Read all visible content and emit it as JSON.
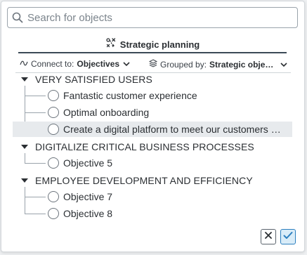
{
  "search": {
    "placeholder": "Search for objects",
    "value": ""
  },
  "tab": {
    "label": "Strategic planning",
    "icon": "strategy-icon"
  },
  "filters": {
    "connect": {
      "prefix": "Connect to:",
      "value": "Objectives"
    },
    "grouped": {
      "prefix": "Grouped by:",
      "value": "Strategic objectives"
    }
  },
  "groups": [
    {
      "label": "VERY SATISFIED USERS",
      "items": [
        {
          "label": "Fantastic customer experience",
          "selected": false
        },
        {
          "label": "Optimal onboarding",
          "selected": false
        },
        {
          "label": "Create a digital platform to meet our customers needs",
          "selected": true
        }
      ]
    },
    {
      "label": "DIGITALIZE CRITICAL BUSINESS PROCESSES",
      "items": [
        {
          "label": "Objective 5",
          "selected": false
        }
      ]
    },
    {
      "label": "EMPLOYEE DEVELOPMENT AND EFFICIENCY",
      "items": [
        {
          "label": "Objective 7",
          "selected": false
        },
        {
          "label": "Objective 8",
          "selected": false
        }
      ]
    }
  ],
  "actions": {
    "cancel_icon": "close-icon",
    "confirm_icon": "check-icon"
  },
  "colors": {
    "accent": "#2c7fbf",
    "selected_row": "#e7eaed",
    "tab_underline": "#3c4a57"
  }
}
